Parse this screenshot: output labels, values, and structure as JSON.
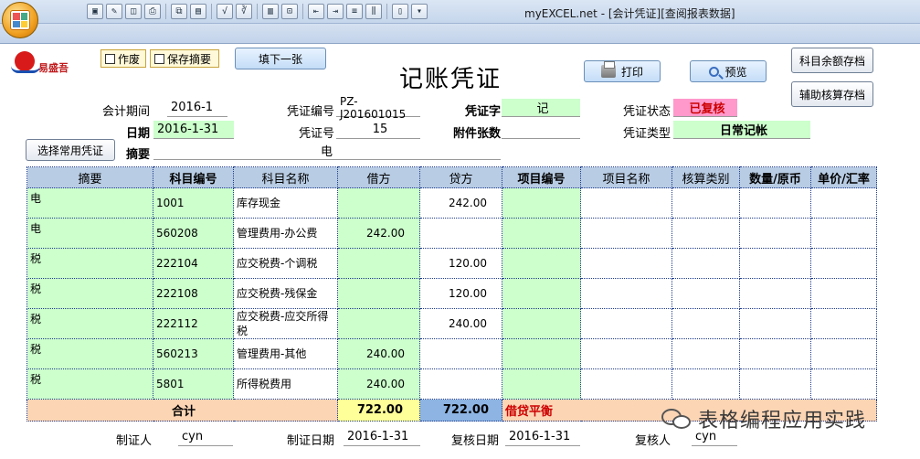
{
  "window": {
    "title": "myEXCEL.net - [会计凭证][查阅报表数据]",
    "toolbar_icons": [
      "save-icon",
      "edit-icon",
      "preview-icon",
      "print-icon",
      "copy-icon",
      "paste-icon",
      "formula-icon",
      "formula-check-icon",
      "clipboard-icon",
      "export-icon",
      "align-left-icon",
      "align-right-icon",
      "row-height-icon",
      "column-width-icon",
      "book-icon",
      "dropdown-icon"
    ]
  },
  "header": {
    "logo_text": "易盛吾",
    "title": "记账凭证",
    "void_label": "作废",
    "save_summary_label": "保存摘要",
    "fill_next_label": "填下一张",
    "print_label": "打印",
    "preview_label": "预览",
    "save_subject_balance_label": "科目余额存档",
    "save_aux_accounting_label": "辅助核算存档",
    "select_common_label": "选择常用凭证"
  },
  "fields": {
    "period_label": "会计期间",
    "period_value": "2016-1",
    "voucher_code_label": "凭证编号",
    "voucher_code_value": "PZ-J201601015",
    "voucher_word_label": "凭证字",
    "voucher_word_value": "记",
    "status_label": "凭证状态",
    "status_value": "已复核",
    "date_label": "日期",
    "date_value": "2016-1-31",
    "voucher_no_label": "凭证号",
    "voucher_no_value": "15",
    "attachments_label": "附件张数",
    "attachments_value": "",
    "type_label": "凭证类型",
    "type_value": "日常记帐",
    "summary_label": "摘要",
    "summary_value": "电"
  },
  "table": {
    "columns": [
      "摘要",
      "科目编号",
      "科目名称",
      "借方",
      "贷方",
      "项目编号",
      "项目名称",
      "核算类别",
      "数量/原币",
      "单价/汇率"
    ],
    "rows": [
      {
        "summary": "电",
        "code": "1001",
        "name": "库存现金",
        "debit": "",
        "credit": "242.00"
      },
      {
        "summary": "电",
        "code": "560208",
        "name": "管理费用-办公费",
        "debit": "242.00",
        "credit": ""
      },
      {
        "summary": "税",
        "code": "222104",
        "name": "应交税费-个调税",
        "debit": "",
        "credit": "120.00"
      },
      {
        "summary": "税",
        "code": "222108",
        "name": "应交税费-残保金",
        "debit": "",
        "credit": "120.00"
      },
      {
        "summary": "税",
        "code": "222112",
        "name": "应交税费-应交所得税",
        "debit": "",
        "credit": "240.00"
      },
      {
        "summary": "税",
        "code": "560213",
        "name": "管理费用-其他",
        "debit": "240.00",
        "credit": ""
      },
      {
        "summary": "税",
        "code": "5801",
        "name": "所得税费用",
        "debit": "240.00",
        "credit": ""
      }
    ],
    "total_label": "合计",
    "total_debit": "722.00",
    "total_credit": "722.00",
    "balance_status": "借贷平衡"
  },
  "footer": {
    "maker_label": "制证人",
    "maker_value": "cyn",
    "make_date_label": "制证日期",
    "make_date_value": "2016-1-31",
    "review_date_label": "复核日期",
    "review_date_value": "2016-1-31",
    "reviewer_label": "复核人",
    "reviewer_value": "cyn"
  },
  "watermark": {
    "text": "表格编程应用实践"
  },
  "colors": {
    "green_cell": "#ccffcc",
    "header_blue": "#b8cce4",
    "total_orange": "#fcd5b4",
    "status_pink": "#ff99cc",
    "balance_red": "#cc0000"
  }
}
